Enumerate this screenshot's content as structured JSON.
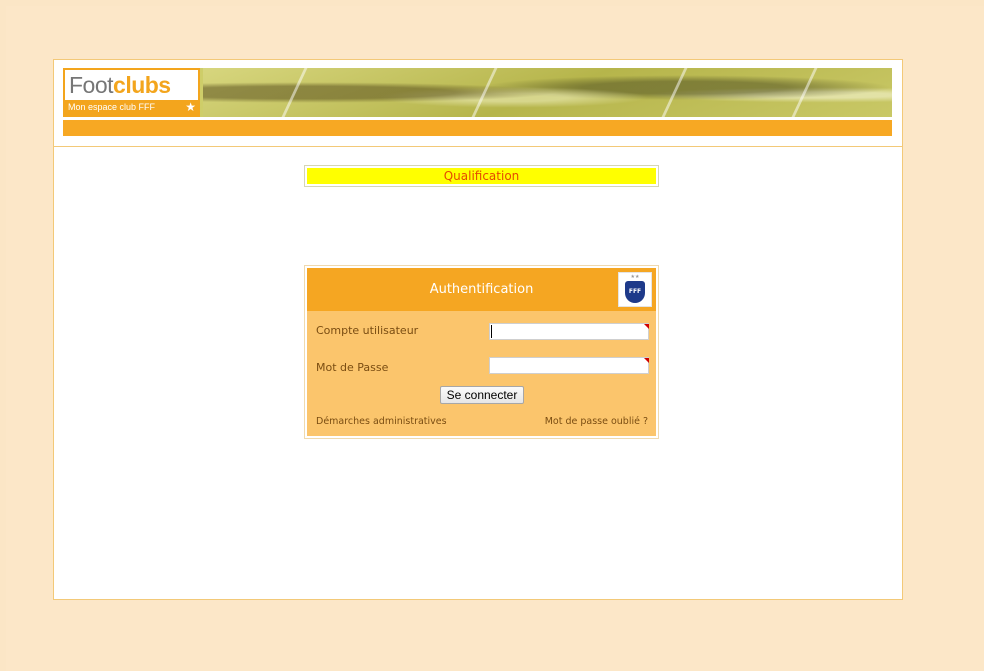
{
  "header": {
    "logo_part1": "Foot",
    "logo_part2": "clubs",
    "logo_tagline": "Mon espace club FFF"
  },
  "qualification": {
    "label": "Qualification"
  },
  "auth": {
    "title": "Authentification",
    "username_label": "Compte utilisateur",
    "username_value": "",
    "password_label": "Mot de Passe",
    "password_value": "",
    "submit_label": "Se connecter",
    "link_admin": "Démarches administratives",
    "link_forgot": "Mot de passe oublié ?",
    "federation_logo_text": "FFF"
  },
  "colors": {
    "accent": "#f5a622",
    "qualification_bg": "#ffff00",
    "qualification_text": "#e64a00",
    "panel_bg": "#fbc56c"
  }
}
